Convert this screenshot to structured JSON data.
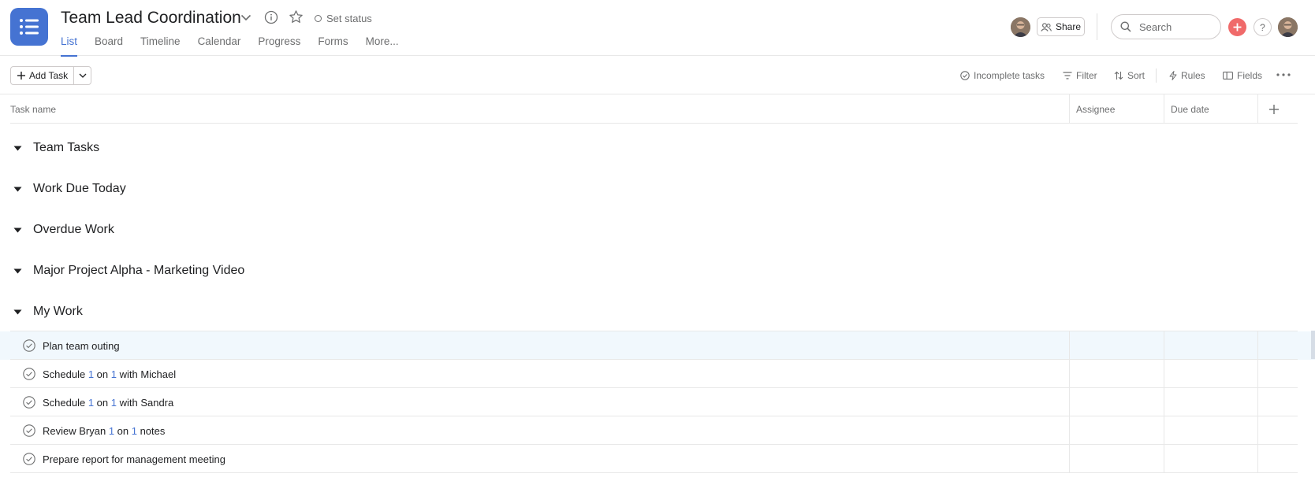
{
  "project": {
    "title": "Team Lead Coordination",
    "set_status_label": "Set status",
    "app_icon": "list-icon",
    "accent_color": "#4573d2"
  },
  "tabs": [
    {
      "label": "List",
      "active": true
    },
    {
      "label": "Board",
      "active": false
    },
    {
      "label": "Timeline",
      "active": false
    },
    {
      "label": "Calendar",
      "active": false
    },
    {
      "label": "Progress",
      "active": false
    },
    {
      "label": "Forms",
      "active": false
    },
    {
      "label": "More...",
      "active": false
    }
  ],
  "header_right": {
    "share_label": "Share",
    "search_placeholder": "Search",
    "help_label": "?",
    "plus_color": "#f06a6a"
  },
  "toolbar": {
    "add_task_label": "Add Task",
    "incomplete_label": "Incomplete tasks",
    "filter_label": "Filter",
    "sort_label": "Sort",
    "rules_label": "Rules",
    "fields_label": "Fields"
  },
  "columns": {
    "task_name": "Task name",
    "assignee": "Assignee",
    "due_date": "Due date"
  },
  "sections": [
    {
      "name": "Team Tasks"
    },
    {
      "name": "Work Due Today"
    },
    {
      "name": "Overdue Work"
    },
    {
      "name": "Major Project Alpha - Marketing Video"
    },
    {
      "name": "My Work"
    }
  ],
  "tasks": [
    {
      "parts": [
        "Plan team outing"
      ],
      "highlighted": true
    },
    {
      "parts": [
        "Schedule ",
        "1",
        " on ",
        "1",
        " with Michael"
      ],
      "highlighted": false
    },
    {
      "parts": [
        "Schedule ",
        "1",
        " on ",
        "1",
        " with Sandra"
      ],
      "highlighted": false
    },
    {
      "parts": [
        "Review Bryan ",
        "1",
        " on ",
        "1",
        " notes"
      ],
      "highlighted": false
    },
    {
      "parts": [
        "Prepare report for management meeting"
      ],
      "highlighted": false
    }
  ]
}
